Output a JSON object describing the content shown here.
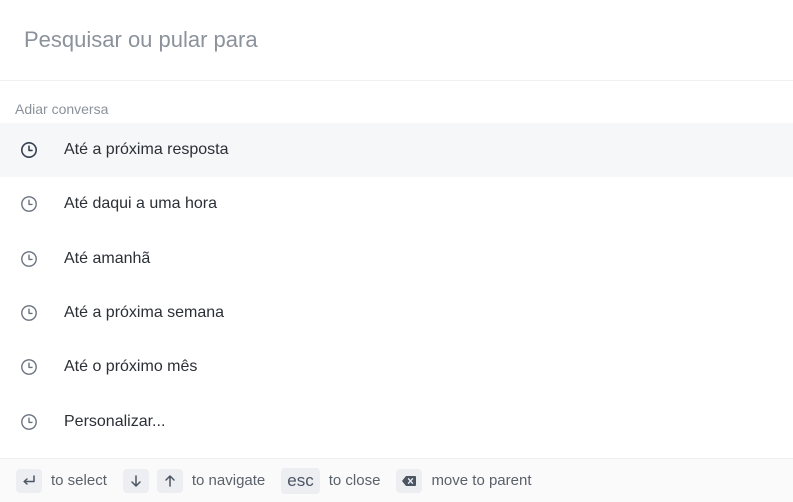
{
  "search": {
    "placeholder": "Pesquisar ou pular para",
    "value": ""
  },
  "section": {
    "title": "Adiar conversa"
  },
  "options": [
    {
      "label": "Até a próxima resposta",
      "icon": "clock-icon",
      "active": true
    },
    {
      "label": "Até daqui a uma hora",
      "icon": "clock-icon",
      "active": false
    },
    {
      "label": "Até amanhã",
      "icon": "clock-icon",
      "active": false
    },
    {
      "label": "Até a próxima semana",
      "icon": "clock-icon",
      "active": false
    },
    {
      "label": "Até o próximo mês",
      "icon": "clock-icon",
      "active": false
    },
    {
      "label": "Personalizar...",
      "icon": "clock-icon",
      "active": false
    }
  ],
  "footer": {
    "select_key": "enter-icon",
    "select_label": "to select",
    "down_key": "arrow-down-icon",
    "up_key": "arrow-up-icon",
    "navigate_label": "to navigate",
    "esc_key": "esc",
    "close_label": "to close",
    "backspace_key": "backspace-icon",
    "parent_label": "move to parent"
  },
  "colors": {
    "active_row": "#f6f7f8",
    "footer_bg": "#fafafa",
    "muted_text": "#8b929b",
    "kbd_bg": "#eceef1"
  }
}
